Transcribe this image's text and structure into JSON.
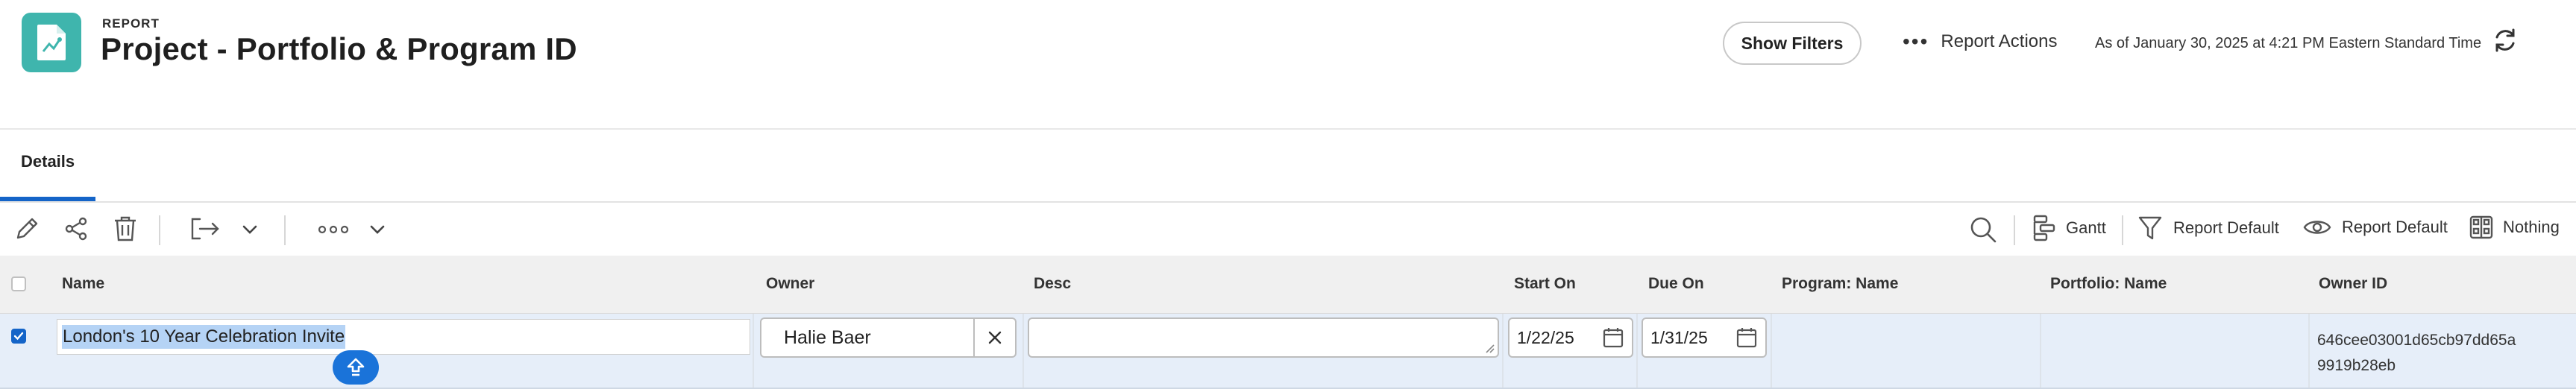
{
  "header": {
    "kicker": "REPORT",
    "title": "Project - Portfolio & Program ID",
    "show_filters": "Show Filters",
    "report_actions": "Report Actions",
    "as_of": "As of January 30, 2025 at 4:21 PM Eastern Standard Time",
    "icon_color": "#3fb5ad"
  },
  "tabs": [
    {
      "label": "Details",
      "active": true
    }
  ],
  "toolbar": {
    "gantt": "Gantt",
    "grouping": "Report Default",
    "view": "Report Default",
    "filter_label": "Nothing"
  },
  "table": {
    "columns": [
      "Name",
      "Owner",
      "Desc",
      "Start On",
      "Due On",
      "Program: Name",
      "Portfolio: Name",
      "Owner ID"
    ],
    "rows": [
      {
        "selected": true,
        "name": "London's 10 Year Celebration Invite",
        "owner": "Halie Baer",
        "desc": "",
        "start_on": "1/22/25",
        "due_on": "1/31/25",
        "program_name": "",
        "portfolio_name": "",
        "owner_id_line1": "646cee03001d65cb97dd65a",
        "owner_id_line2": "9919b28eb"
      }
    ]
  },
  "colors": {
    "accent": "#1464c8",
    "row_selected": "#e6eef9"
  }
}
